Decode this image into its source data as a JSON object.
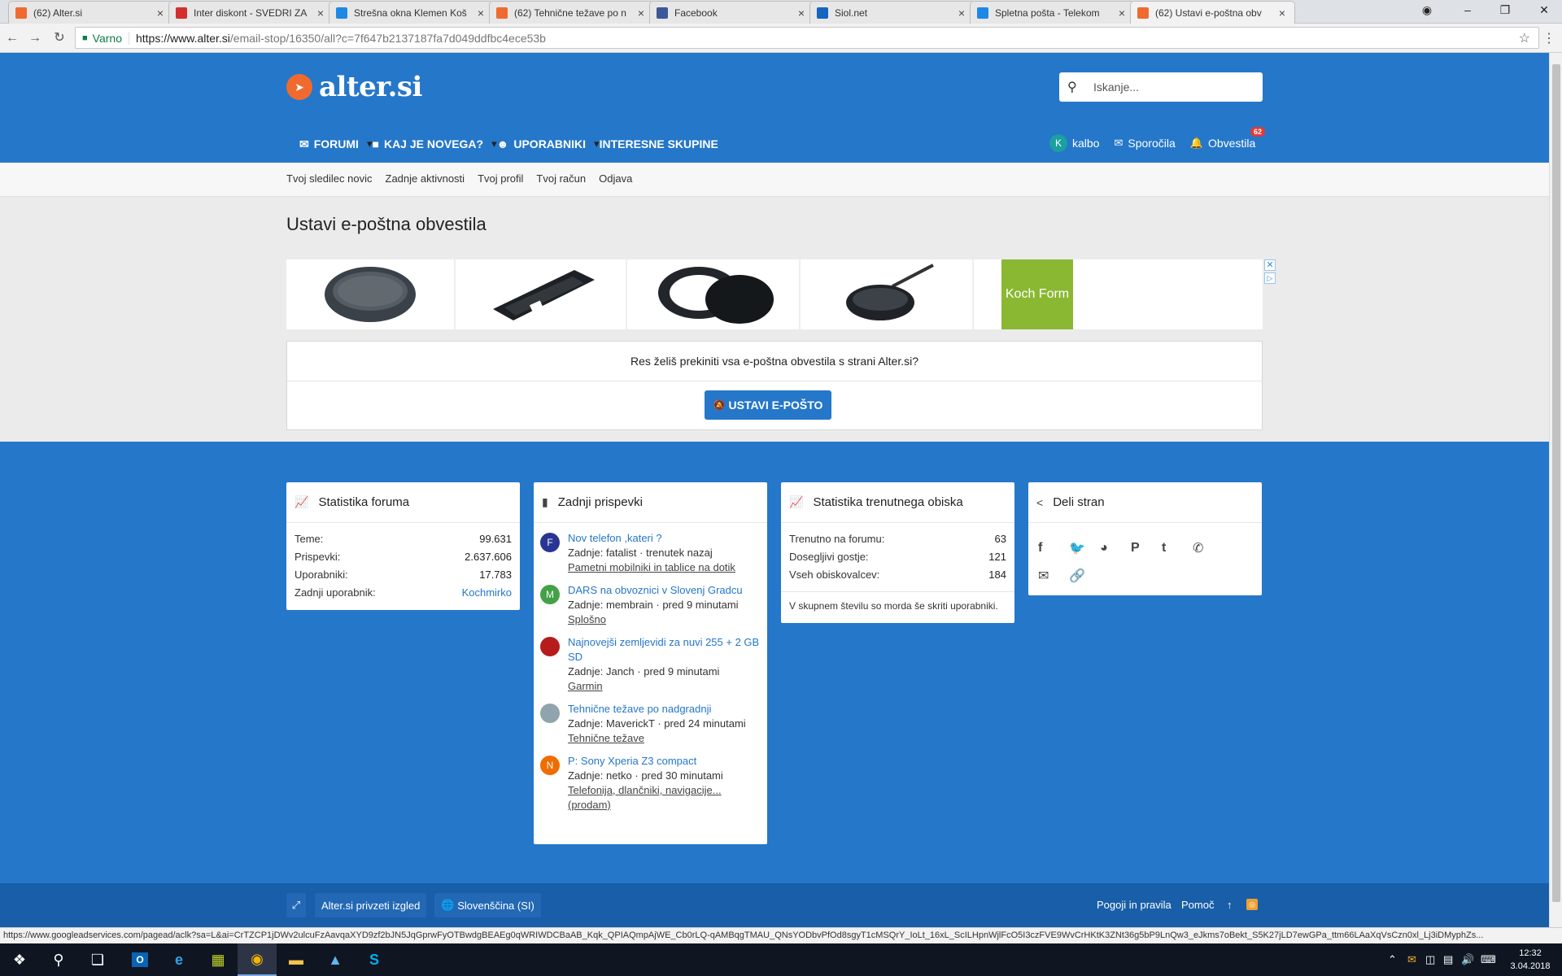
{
  "browser": {
    "tabs": [
      {
        "label": "(62) Alter.si",
        "color": "#f06a30"
      },
      {
        "label": "Inter diskont - SVEDRI ZA",
        "color": "#d32f2f"
      },
      {
        "label": "Strešna okna Klemen Koš",
        "color": "#1e88e5"
      },
      {
        "label": "(62) Tehnične težave po n",
        "color": "#f06a30"
      },
      {
        "label": "Facebook",
        "color": "#3b5998"
      },
      {
        "label": "Siol.net",
        "color": "#1565c0"
      },
      {
        "label": "Spletna pošta - Telekom",
        "color": "#1e88e5"
      },
      {
        "label": "(62) Ustavi e-poštna obv",
        "color": "#f06a30"
      }
    ],
    "secure_label": "Varno",
    "url_host": "https://www.alter.si",
    "url_path": "/email-stop/16350/all?c=7f647b2137187fa7d049ddfbc4ece53b",
    "status_url": "https://www.googleadservices.com/pagead/aclk?sa=L&ai=CrTZCP1jDWv2ulcuFzAavqaXYD9zf2bJN5JqGprwFyOTBwdgBEAEg0qWRIWDCBaAB_Kqk_QPIAQmpAjWE_Cb0rLQ-qAMBqgTMAU_QNsYODbvPfOd8sgyT1cMSQrY_IoLt_16xL_ScILHpnWjlFcO5I3czFVE9WvCrHKtK3ZNt36g5bP9LnQw3_eJkms7oBekt_S5K27jLD7ewGPa_ttm66LAaXqVsCzn0xl_Lj3iDMyphZs..."
  },
  "site": {
    "logo_text": "alter.si",
    "search_placeholder": "Iskanje...",
    "nav": [
      {
        "label": "FORUMI",
        "icon": "forum-icon",
        "caret": true
      },
      {
        "label": "KAJ JE NOVEGA?",
        "icon": "whats-new-icon",
        "caret": true
      },
      {
        "label": "UPORABNIKI",
        "icon": "users-icon",
        "caret": true
      },
      {
        "label": "INTERESNE SKUPINE",
        "icon": "",
        "caret": false
      }
    ],
    "user": {
      "initial": "K",
      "name": "kalbo",
      "messages": "Sporočila",
      "alerts": "Obvestila",
      "alerts_count": "62"
    },
    "subnav": [
      "Tvoj sledilec novic",
      "Zadnje aktivnosti",
      "Tvoj profil",
      "Tvoj račun",
      "Odjava"
    ]
  },
  "main": {
    "title": "Ustavi e-poštna obvestila",
    "ad_brand": "Koch Form",
    "question": "Res želiš prekiniti vsa e-poštna obvestila s strani Alter.si?",
    "stop_button": "USTAVI E-POŠTO"
  },
  "widgets": {
    "forum_stats": {
      "title": "Statistika foruma",
      "rows": [
        {
          "label": "Teme:",
          "value": "99.631"
        },
        {
          "label": "Prispevki:",
          "value": "2.637.606"
        },
        {
          "label": "Uporabniki:",
          "value": "17.783"
        },
        {
          "label": "Zadnji uporabnik:",
          "value": "Kochmirko"
        }
      ]
    },
    "latest_posts": {
      "title": "Zadnji prispevki",
      "posts": [
        {
          "avatar": "F",
          "color": "#283593",
          "title": "Nov telefon ,kateri ?",
          "meta": "Zadnje: fatalist · trenutek nazaj",
          "forum": "Pametni mobilniki in tablice na dotik"
        },
        {
          "avatar": "M",
          "color": "#43a047",
          "title": "DARS na obvoznici v Slovenj Gradcu",
          "meta": "Zadnje: membrain · pred 9 minutami",
          "forum": "Splošno"
        },
        {
          "avatar": "",
          "color": "#b71c1c",
          "title": "Najnovejši zemljevidi za nuvi 255 + 2 GB SD",
          "meta": "Zadnje: Janch · pred 9 minutami",
          "forum": "Garmin"
        },
        {
          "avatar": "",
          "color": "#90a4ae",
          "title": "Tehnične težave po nadgradnji",
          "meta": "Zadnje: MaverickT · pred 24 minutami",
          "forum": "Tehnične težave"
        },
        {
          "avatar": "N",
          "color": "#ef6c00",
          "title": "P: Sony Xperia Z3 compact",
          "meta": "Zadnje: netko · pred 30 minutami",
          "forum": "Telefonija, dlančniki, navigacije... (prodam)"
        }
      ]
    },
    "visit_stats": {
      "title": "Statistika trenutnega obiska",
      "rows": [
        {
          "label": "Trenutno na forumu:",
          "value": "63"
        },
        {
          "label": "Dosegljivi gostje:",
          "value": "121"
        },
        {
          "label": "Vseh obiskovalcev:",
          "value": "184"
        }
      ],
      "note": "V skupnem številu so morda še skriti uporabniki."
    },
    "share": {
      "title": "Deli stran"
    }
  },
  "footer": {
    "style_button": "Alter.si privzeti izgled",
    "language_button": "Slovenščina (SI)",
    "terms": "Pogoji in pravila",
    "help": "Pomoč"
  },
  "taskbar": {
    "time": "12:32",
    "date": "3.04.2018"
  }
}
